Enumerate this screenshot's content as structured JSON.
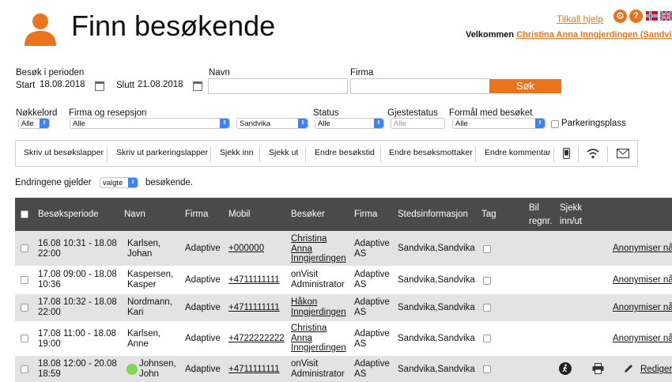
{
  "header": {
    "title": "Finn besøkende",
    "help_link": "Tilkall hjelp",
    "welcome_prefix": "Velkommen",
    "user_name": "Christina Anna Inngjerdingen (Sandvika)"
  },
  "filters": {
    "period_label": "Besøk i perioden",
    "start_label": "Start",
    "start_value": "18.08.2018",
    "end_label": "Slutt",
    "end_value": "21.08.2018",
    "name_label": "Navn",
    "company_label": "Firma",
    "search_button": "Søk",
    "keyword_label": "Nøkkelord",
    "keyword_value": "Alle",
    "company_reception_label": "Firma og resepsjon",
    "company_reception_value": "Alle",
    "reception_value": "Sandvika",
    "status_label": "Status",
    "status_value": "Alle",
    "guest_status_label": "Gjestestatus",
    "guest_status_value": "Alle",
    "purpose_label": "Formål med besøket",
    "purpose_value": "Alle",
    "parking_label": "Parkeringsplass"
  },
  "toolbar": {
    "print_visitor_slips": "Skriv ut besøkslapper",
    "print_parking_slips": "Skriv ut parkeringslapper",
    "check_in": "Sjekk inn",
    "check_out": "Sjekk ut",
    "change_visit_time": "Endre besøkstid",
    "change_recipient": "Endre besøksmottaker",
    "change_comment": "Endre kommentar",
    "icons": [
      "phone-icon",
      "wifi-icon",
      "mail-icon"
    ]
  },
  "changes": {
    "prefix": "Endringene gjelder",
    "scope_value": "valgte",
    "suffix": "besøkende."
  },
  "table": {
    "columns": {
      "period": "Besøksperiode",
      "name": "Navn",
      "company": "Firma",
      "mobile": "Mobil",
      "visitor": "Besøker",
      "visitor_company": "Firma",
      "location": "Stedsinformasjon",
      "tag": "Tag",
      "car_1": "Bil",
      "car_2": "regnr.",
      "check_1": "Sjekk",
      "check_2": "inn/ut"
    },
    "rows": [
      {
        "period_1": "16.08 10:31 - 18.08",
        "period_2": "22:00",
        "name_1": "Karlsen,",
        "name_2": "Johan",
        "company": "Adaptive",
        "mobile": "+000000",
        "host_1": "Christina",
        "host_2": "Anna",
        "host_3": "Inngjerdingen",
        "host_company_1": "Adaptive",
        "host_company_2": "AS",
        "location": "Sandvika,Sandvika",
        "action": "Anonymiser nå"
      },
      {
        "period_1": "17.08 09:00 - 18.08",
        "period_2": "10:36",
        "name_1": "Kaspersen,",
        "name_2": "Kasper",
        "company": "Adaptive",
        "mobile": "+4711111111",
        "host_1": "onVisit",
        "host_2": "Administrator",
        "host_company_1": "Adaptive",
        "host_company_2": "AS",
        "location": "Sandvika,Sandvika",
        "action": "Anonymiser nå"
      },
      {
        "period_1": "17.08 10:32 - 18.08",
        "period_2": "22:00",
        "name_1": "Nordmann,",
        "name_2": "Kari",
        "company": "Adaptive",
        "mobile": "+4711111111",
        "host_1": "Håkon",
        "host_2": "Inngjerdingen",
        "host_company_1": "Adaptive",
        "host_company_2": "AS",
        "location": "Sandvika,Sandvika",
        "action": "Anonymiser nå"
      },
      {
        "period_1": "17.08 11:00 - 18.08",
        "period_2": "19:00",
        "name_1": "Karlsen,",
        "name_2": "Anne",
        "company": "Adaptive",
        "mobile": "+4722222222",
        "host_1": "Christina",
        "host_2": "Anna",
        "host_3": "Inngjerdingen",
        "host_company_1": "Adaptive",
        "host_company_2": "AS",
        "location": "Sandvika,Sandvika",
        "action": "Anonymiser nå"
      },
      {
        "period_1": "18.08 12:00 - 20.08",
        "period_2": "18:59",
        "name_1": "Johnsen,",
        "name_2": "John",
        "company": "Adaptive",
        "mobile": "+4711111111",
        "host_1": "onVisit",
        "host_2": "Administrator",
        "host_company_1": "Adaptive",
        "host_company_2": "AS",
        "location": "Sandvika,Sandvika",
        "action": "Rediger"
      }
    ]
  },
  "colors": {
    "accent": "#e8741e",
    "table_header": "#4a4a4a",
    "row_alt": "#e3e3e3",
    "status_dot": "#7ed957"
  }
}
